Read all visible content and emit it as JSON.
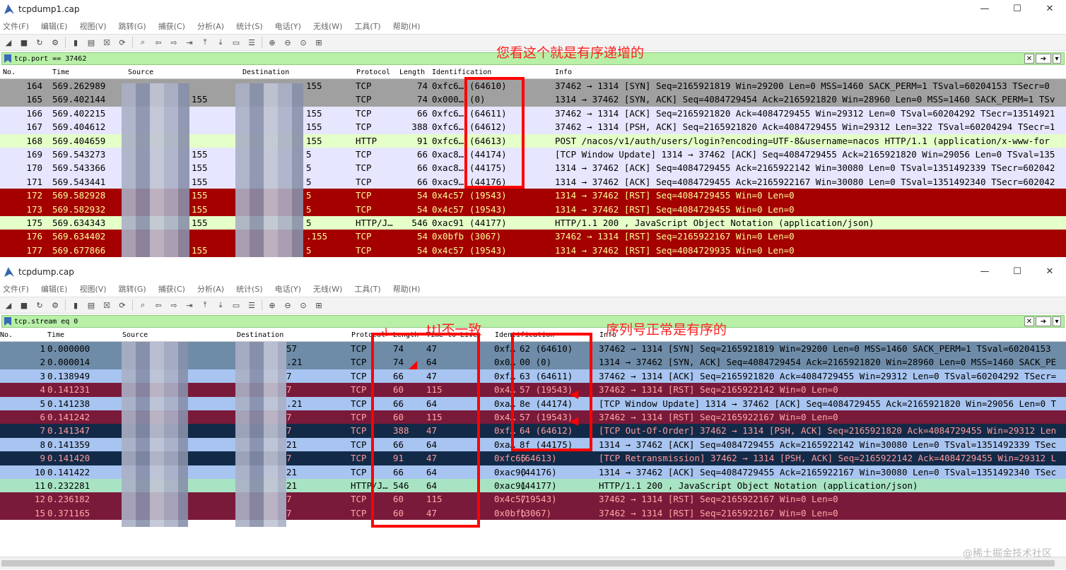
{
  "window1": {
    "title": "tcpdump1.cap",
    "controls": [
      "—",
      "☐",
      "✕"
    ],
    "menu": [
      "文件(F)",
      "编辑(E)",
      "视图(V)",
      "跳转(G)",
      "捕获(C)",
      "分析(A)",
      "统计(S)",
      "电话(Y)",
      "无线(W)",
      "工具(T)",
      "帮助(H)"
    ],
    "filter": "tcp.port == 37462",
    "columns": [
      "No.",
      "Time",
      "Source",
      "Destination",
      "Protocol",
      "Length",
      "Identification",
      "Info"
    ],
    "annotation": "您看这个就是有序递增的",
    "rows": [
      {
        "no": "164",
        "time": "569.262989",
        "src": "",
        "dst": "155",
        "proto": "TCP",
        "len": "74",
        "id": "0xfc6…",
        "idn": "(64610)",
        "info": "37462 → 1314 [SYN] Seq=2165921819 Win=29200 Len=0 MSS=1460 SACK_PERM=1 TSval=60204153 TSecr=0",
        "bg": "#a0a0a0",
        "fg": "#000"
      },
      {
        "no": "165",
        "time": "569.402144",
        "src": "155",
        "dst": "",
        "proto": "TCP",
        "len": "74",
        "id": "0x000…",
        "idn": "(0)",
        "info": "1314 → 37462 [SYN, ACK] Seq=4084729454 Ack=2165921820 Win=28960 Len=0 MSS=1460 SACK_PERM=1 TSv",
        "bg": "#a0a0a0",
        "fg": "#000"
      },
      {
        "no": "166",
        "time": "569.402215",
        "src": "",
        "dst": "155",
        "proto": "TCP",
        "len": "66",
        "id": "0xfc6…",
        "idn": "(64611)",
        "info": "37462 → 1314 [ACK] Seq=2165921820 Ack=4084729455 Win=29312 Len=0 TSval=60204292 TSecr=13514921",
        "bg": "#e7e6ff",
        "fg": "#000"
      },
      {
        "no": "167",
        "time": "569.404612",
        "src": "",
        "dst": "155",
        "proto": "TCP",
        "len": "388",
        "id": "0xfc6…",
        "idn": "(64612)",
        "info": "37462 → 1314 [PSH, ACK] Seq=2165921820 Ack=4084729455 Win=29312 Len=322 TSval=60204294 TSecr=1",
        "bg": "#e7e6ff",
        "fg": "#000"
      },
      {
        "no": "168",
        "time": "569.404659",
        "src": "",
        "dst": "155",
        "proto": "HTTP",
        "len": "91",
        "id": "0xfc6…",
        "idn": "(64613)",
        "info": "POST /nacos/v1/auth/users/login?encoding=UTF-8&username=nacos HTTP/1.1  (application/x-www-for",
        "bg": "#e4ffc7",
        "fg": "#000"
      },
      {
        "no": "169",
        "time": "569.543273",
        "src": "155",
        "dst": "5",
        "proto": "TCP",
        "len": "66",
        "id": "0xac8…",
        "idn": "(44174)",
        "info": "[TCP Window Update] 1314 → 37462 [ACK] Seq=4084729455 Ack=2165921820 Win=29056 Len=0 TSval=135",
        "bg": "#e7e6ff",
        "fg": "#000"
      },
      {
        "no": "170",
        "time": "569.543366",
        "src": "155",
        "dst": "5",
        "proto": "TCP",
        "len": "66",
        "id": "0xac8…",
        "idn": "(44175)",
        "info": "1314 → 37462 [ACK] Seq=4084729455 Ack=2165922142 Win=30080 Len=0 TSval=1351492339 TSecr=602042",
        "bg": "#e7e6ff",
        "fg": "#000"
      },
      {
        "no": "171",
        "time": "569.543441",
        "src": "155",
        "dst": "5",
        "proto": "TCP",
        "len": "66",
        "id": "0xac9…",
        "idn": "(44176)",
        "info": "1314 → 37462 [ACK] Seq=4084729455 Ack=2165922167 Win=30080 Len=0 TSval=1351492340 TSecr=602042",
        "bg": "#e7e6ff",
        "fg": "#000"
      },
      {
        "no": "172",
        "time": "569.582928",
        "src": "155",
        "dst": "5",
        "proto": "TCP",
        "len": "54",
        "id": "0x4c57",
        "idn": "(19543)",
        "info": "1314 → 37462 [RST] Seq=4084729455 Win=0 Len=0",
        "bg": "#a40000",
        "fg": "#fffc9c"
      },
      {
        "no": "173",
        "time": "569.582932",
        "src": "155",
        "dst": "5",
        "proto": "TCP",
        "len": "54",
        "id": "0x4c57",
        "idn": "(19543)",
        "info": "1314 → 37462 [RST] Seq=4084729455 Win=0 Len=0",
        "bg": "#a40000",
        "fg": "#fffc9c"
      },
      {
        "no": "175",
        "time": "569.634343",
        "src": "155",
        "dst": "5",
        "proto": "HTTP/J…",
        "len": "546",
        "id": "0xac91",
        "idn": "(44177)",
        "info": "HTTP/1.1 200  , JavaScript Object Notation (application/json)",
        "bg": "#e4ffc7",
        "fg": "#000"
      },
      {
        "no": "176",
        "time": "569.634402",
        "src": "",
        "dst": ".155",
        "proto": "TCP",
        "len": "54",
        "id": "0x0bfb",
        "idn": "(3067)",
        "info": "37462 → 1314 [RST] Seq=2165922167 Win=0 Len=0",
        "bg": "#a40000",
        "fg": "#fffc9c"
      },
      {
        "no": "177",
        "time": "569.677866",
        "src": "155",
        "dst": "5",
        "proto": "TCP",
        "len": "54",
        "id": "0x4c57",
        "idn": "(19543)",
        "info": "1314 → 37462 [RST] Seq=4084729935 Win=0 Len=0",
        "bg": "#a40000",
        "fg": "#fffc9c"
      }
    ]
  },
  "window2": {
    "title": "tcpdump.cap",
    "controls": [
      "—",
      "☐",
      "✕"
    ],
    "menu": [
      "文件(F)",
      "编辑(E)",
      "视图(V)",
      "跳转(G)",
      "捕获(C)",
      "分析(A)",
      "统计(S)",
      "电话(Y)",
      "无线(W)",
      "工具(T)",
      "帮助(H)"
    ],
    "filter": "tcp.stream eq 0",
    "columns": [
      "No.",
      "Time",
      "Source",
      "Destination",
      "Protocol",
      "Length",
      "Time to Live",
      "Identification",
      "Info"
    ],
    "annotation_ttl": "ttl不一致",
    "annotation_seq": "序列号正常是有序的",
    "rows": [
      {
        "no": "1",
        "time": "0.000000",
        "src": "",
        "dst": "57",
        "proto": "TCP",
        "len": "74",
        "ttl": "47",
        "id": "0xf…",
        "idn": "62 (64610)",
        "info": "37462 → 1314 [SYN] Seq=2165921819 Win=29200 Len=0 MSS=1460 SACK_PERM=1 TSval=60204153",
        "bg": "#6e8ca8",
        "fg": "#000"
      },
      {
        "no": "2",
        "time": "0.000014",
        "src": "",
        "dst": ".21",
        "proto": "TCP",
        "len": "74",
        "ttl": "64",
        "id": "0x0…",
        "idn": "00 (0)",
        "info": "1314 → 37462 [SYN, ACK] Seq=4084729454 Ack=2165921820 Win=28960 Len=0 MSS=1460 SACK_PE",
        "bg": "#6e8ca8",
        "fg": "#000"
      },
      {
        "no": "3",
        "time": "0.138949",
        "src": "",
        "dst": "7",
        "proto": "TCP",
        "len": "66",
        "ttl": "47",
        "id": "0xf…",
        "idn": "63 (64611)",
        "info": "37462 → 1314 [ACK] Seq=2165921820 Ack=4084729455 Win=29312 Len=0 TSval=60204292 TSecr=",
        "bg": "#a8c4f0",
        "fg": "#000"
      },
      {
        "no": "4",
        "time": "0.141231",
        "src": "",
        "dst": "7",
        "proto": "TCP",
        "len": "60",
        "ttl": "115",
        "id": "0x4…",
        "idn": "57 (19543)",
        "info": "37462 → 1314 [RST] Seq=2165922142 Win=0 Len=0",
        "bg": "#7a1a3a",
        "fg": "#ffa8a8"
      },
      {
        "no": "5",
        "time": "0.141238",
        "src": "",
        "dst": ".21",
        "proto": "TCP",
        "len": "66",
        "ttl": "64",
        "id": "0xa…",
        "idn": "8e (44174)",
        "info": "[TCP Window Update] 1314 → 37462 [ACK] Seq=4084729455 Ack=2165921820 Win=29056 Len=0 T",
        "bg": "#a8c4f0",
        "fg": "#000"
      },
      {
        "no": "6",
        "time": "0.141242",
        "src": "",
        "dst": "7",
        "proto": "TCP",
        "len": "60",
        "ttl": "115",
        "id": "0x4…",
        "idn": "57 (19543)",
        "info": "37462 → 1314 [RST] Seq=2165922167 Win=0 Len=0",
        "bg": "#7a1a3a",
        "fg": "#ffa8a8"
      },
      {
        "no": "7",
        "time": "0.141347",
        "src": "",
        "dst": "7",
        "proto": "TCP",
        "len": "388",
        "ttl": "47",
        "id": "0xf…",
        "idn": "64 (64612)",
        "info": "[TCP Out-Of-Order] 37462 → 1314 [PSH, ACK] Seq=2165921820 Ack=4084729455 Win=29312 Len",
        "bg": "#122a48",
        "fg": "#ff9a9a"
      },
      {
        "no": "8",
        "time": "0.141359",
        "src": "",
        "dst": "21",
        "proto": "TCP",
        "len": "66",
        "ttl": "64",
        "id": "0xa…",
        "idn": "8f (44175)",
        "info": "1314 → 37462 [ACK] Seq=4084729455 Ack=2165922142 Win=30080 Len=0 TSval=1351492339 TSec",
        "bg": "#a8c4f0",
        "fg": "#000"
      },
      {
        "no": "9",
        "time": "0.141420",
        "src": "",
        "dst": "7",
        "proto": "TCP",
        "len": "91",
        "ttl": "47",
        "id": "0xfc65",
        "idn": "(64613)",
        "info": "[TCP Retransmission] 37462 → 1314 [PSH, ACK] Seq=2165922142 Ack=4084729455 Win=29312 L",
        "bg": "#122a48",
        "fg": "#ff9a9a"
      },
      {
        "no": "10",
        "time": "0.141422",
        "src": "",
        "dst": "21",
        "proto": "TCP",
        "len": "66",
        "ttl": "64",
        "id": "0xac90",
        "idn": "(44176)",
        "info": "1314 → 37462 [ACK] Seq=4084729455 Ack=2165922167 Win=30080 Len=0 TSval=1351492340 TSec",
        "bg": "#a8c4f0",
        "fg": "#000"
      },
      {
        "no": "11",
        "time": "0.232281",
        "src": "",
        "dst": "21",
        "proto": "HTTP/J…",
        "len": "546",
        "ttl": "64",
        "id": "0xac91",
        "idn": "(44177)",
        "info": "HTTP/1.1 200  , JavaScript Object Notation (application/json)",
        "bg": "#a8e4c4",
        "fg": "#000"
      },
      {
        "no": "12",
        "time": "0.236182",
        "src": "",
        "dst": "7",
        "proto": "TCP",
        "len": "60",
        "ttl": "115",
        "id": "0x4c57",
        "idn": "(19543)",
        "info": "37462 → 1314 [RST] Seq=2165922167 Win=0 Len=0",
        "bg": "#7a1a3a",
        "fg": "#ffa8a8"
      },
      {
        "no": "15",
        "time": "0.371165",
        "src": "",
        "dst": "7",
        "proto": "TCP",
        "len": "60",
        "ttl": "47",
        "id": "0x0bfb",
        "idn": "(3067)",
        "info": "37462 → 1314 [RST] Seq=2165922167 Win=0 Len=0",
        "bg": "#7a1a3a",
        "fg": "#ffa8a8"
      }
    ]
  },
  "watermark": "@稀土掘金技术社区"
}
